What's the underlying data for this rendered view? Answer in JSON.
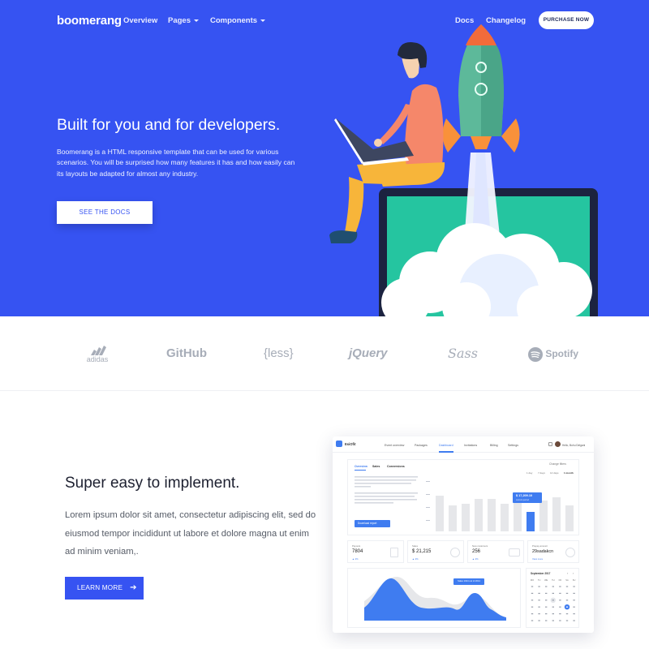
{
  "nav": {
    "brand": "boomerang",
    "items": [
      "Overview",
      "Pages",
      "Components"
    ],
    "right_items": [
      "Docs",
      "Changelog"
    ],
    "purchase_label": "PURCHASE NOW"
  },
  "hero": {
    "title": "Built for you and for developers.",
    "description": "Boomerang is a HTML responsive template that can be used for various scenarios. You will be surprised how many features it has and how easily can its layouts be adapted for almost any industry.",
    "button_label": "SEE THE DOCS"
  },
  "logos": [
    "adidas",
    "GitHub",
    "{less}",
    "jQuery",
    "Sass",
    "Spotify"
  ],
  "feature": {
    "title": "Super easy to implement.",
    "text": "Lorem ipsum dolor sit amet, consectetur adipiscing elit, sed do eiusmod tempor incididunt ut labore et dolore magna ut enim ad minim veniam,.",
    "button_label": "LEARN MORE",
    "button_icon": "arrow-right-icon"
  },
  "dashboard": {
    "brand": "EsiOfit",
    "nav_items": [
      "Event overview",
      "Packages",
      "Dashboard",
      "Invitations",
      "Billing",
      "Settings"
    ],
    "active_nav": "Dashboard",
    "user_name": "Hello, Buhu Delgani",
    "tabs": [
      "Overview",
      "Sales",
      "Conversions"
    ],
    "change_filters": "Change filters",
    "range_tabs": [
      "1 day",
      "7 days",
      "14 days",
      "1 month"
    ],
    "tooltip_value": "$ 17,209.10",
    "tooltip_sub": "current period",
    "download_label": "Download report",
    "stats": [
      {
        "label": "Payouts",
        "value": "7804",
        "delta": "▲ 4%"
      },
      {
        "label": "Sales",
        "value": "$ 21,215",
        "delta": "▲ 4%"
      },
      {
        "label": "New customers",
        "value": "256",
        "delta": "▲ 4%"
      },
      {
        "label": "Prepay amount",
        "value": "29sadakcn",
        "delta": "View more"
      }
    ],
    "area_tooltip": "Sales 1024 out of 2014",
    "calendar_title": "September 2017",
    "weekdays": [
      "MO",
      "TU",
      "WE",
      "TH",
      "FR",
      "SA",
      "SU"
    ],
    "accent": "#3f7cf0"
  },
  "colors": {
    "hero_bg": "#3653f2",
    "button_primary": "#3653f2"
  }
}
